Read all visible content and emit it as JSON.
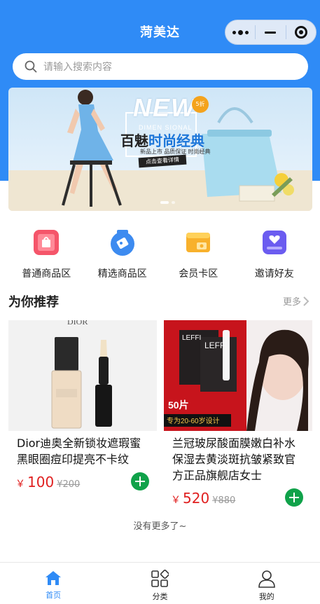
{
  "header": {
    "title": "菏美达",
    "bg_color": "#2f8bf6"
  },
  "capsule": {
    "more_icon": "more-dots-icon",
    "minimize_icon": "minimize-icon",
    "close_icon": "target-close-icon"
  },
  "search": {
    "placeholder": "请输入搜索内容",
    "icon": "search-icon"
  },
  "banner": {
    "headline_new": "NEW",
    "brand_line": "DIMEN SIONAL",
    "headline_a": "百魅",
    "headline_b": "时尚经典",
    "small_text": "新品上市 品质保证 时尚经典",
    "cta": "点击查看详情",
    "badge": "5折",
    "pages": 2,
    "active_page": 1
  },
  "categories": [
    {
      "label": "普通商品区",
      "icon": "bag-icon",
      "color": "#f5556a"
    },
    {
      "label": "精选商品区",
      "icon": "ticket-icon",
      "color": "#3d8bf0"
    },
    {
      "label": "会员卡区",
      "icon": "member-card-icon",
      "color": "#f8b12c"
    },
    {
      "label": "邀请好友",
      "icon": "invite-heart-icon",
      "color": "#6b5cf0"
    }
  ],
  "section": {
    "title": "为你推荐",
    "more": "更多"
  },
  "products": [
    {
      "name": "Dior迪奥全新锁妆遮瑕蜜黑眼圈痘印提亮不卡纹",
      "currency": "￥",
      "price": "100",
      "old_price": "¥200",
      "image_brand": "DIOR"
    },
    {
      "name": "兰冠玻尿酸面膜嫩白补水保湿去黄淡斑抗皱紧致官方正品旗舰店女士",
      "currency": "￥",
      "price": "520",
      "old_price": "¥880",
      "image_brand": "LEFFI",
      "image_badge": "50片",
      "image_caption": "专为20-60岁设计"
    }
  ],
  "end_note": "没有更多了~",
  "tabbar": [
    {
      "label": "首页",
      "icon": "home-icon",
      "active": true
    },
    {
      "label": "分类",
      "icon": "category-grid-icon",
      "active": false
    },
    {
      "label": "我的",
      "icon": "user-icon",
      "active": false
    }
  ],
  "colors": {
    "accent": "#2f8bf6",
    "price": "#e02020",
    "add_button": "#10a24a"
  }
}
